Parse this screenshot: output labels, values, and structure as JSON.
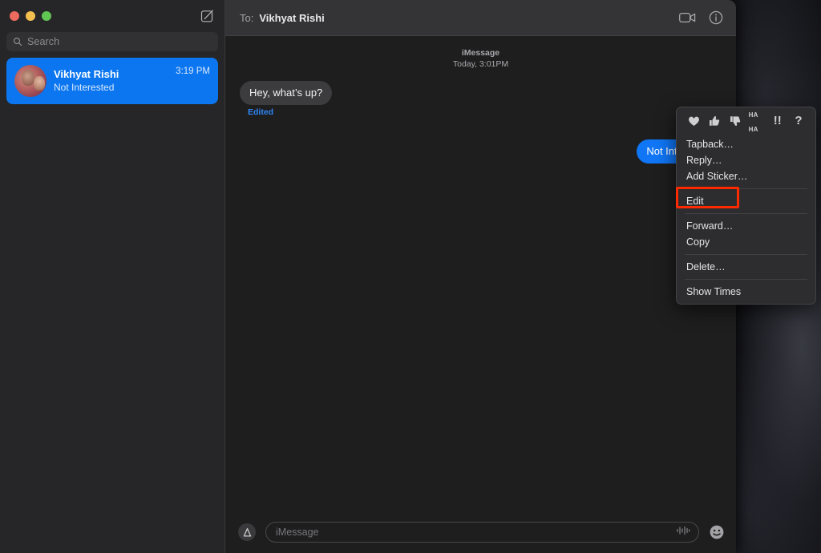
{
  "window": {
    "traffic_lights": [
      {
        "name": "close",
        "color": "#ed6a5e"
      },
      {
        "name": "minimize",
        "color": "#f5bf4f"
      },
      {
        "name": "maximize",
        "color": "#61c554"
      }
    ]
  },
  "sidebar": {
    "compose_icon": "compose-icon",
    "search": {
      "icon": "search-icon",
      "placeholder": "Search",
      "value": ""
    },
    "conversations": [
      {
        "name": "Vikhyat Rishi",
        "preview": "Not Interested",
        "time": "3:19 PM",
        "selected": true,
        "avatar": "contact-photo"
      }
    ]
  },
  "chat": {
    "header": {
      "to_label": "To:",
      "recipient": "Vikhyat Rishi",
      "facetime_icon": "video-camera-icon",
      "info_icon": "info-circle-icon"
    },
    "timestamp": {
      "service": "iMessage",
      "when": "Today, 3:01PM"
    },
    "messages": [
      {
        "id": "msg-incoming-1",
        "direction": "incoming",
        "text": "Hey, what’s up?",
        "edited_label": "Edited"
      },
      {
        "id": "msg-outgoing-1",
        "direction": "outgoing",
        "text": "Not Interested"
      }
    ],
    "composer": {
      "apps_icon": "app-store-icon",
      "placeholder": "iMessage",
      "value": "",
      "audio_icon": "audio-waveform-icon",
      "emoji_icon": "emoji-smiley-icon"
    }
  },
  "context_menu": {
    "tapbacks": [
      {
        "name": "heart",
        "glyph": "♥"
      },
      {
        "name": "thumbs-up",
        "glyph": "👍"
      },
      {
        "name": "thumbs-down",
        "glyph": "👎"
      },
      {
        "name": "haha",
        "line1": "HA",
        "line2": "HA"
      },
      {
        "name": "exclamation",
        "glyph": "!!"
      },
      {
        "name": "question",
        "glyph": "?"
      }
    ],
    "groups": [
      [
        "Tapback…",
        "Reply…",
        "Add Sticker…"
      ],
      [
        "Edit"
      ],
      [
        "Forward…",
        "Copy"
      ],
      [
        "Delete…"
      ],
      [
        "Show Times"
      ]
    ],
    "highlighted_item": "Edit",
    "highlight_color": "#ff2a00"
  }
}
